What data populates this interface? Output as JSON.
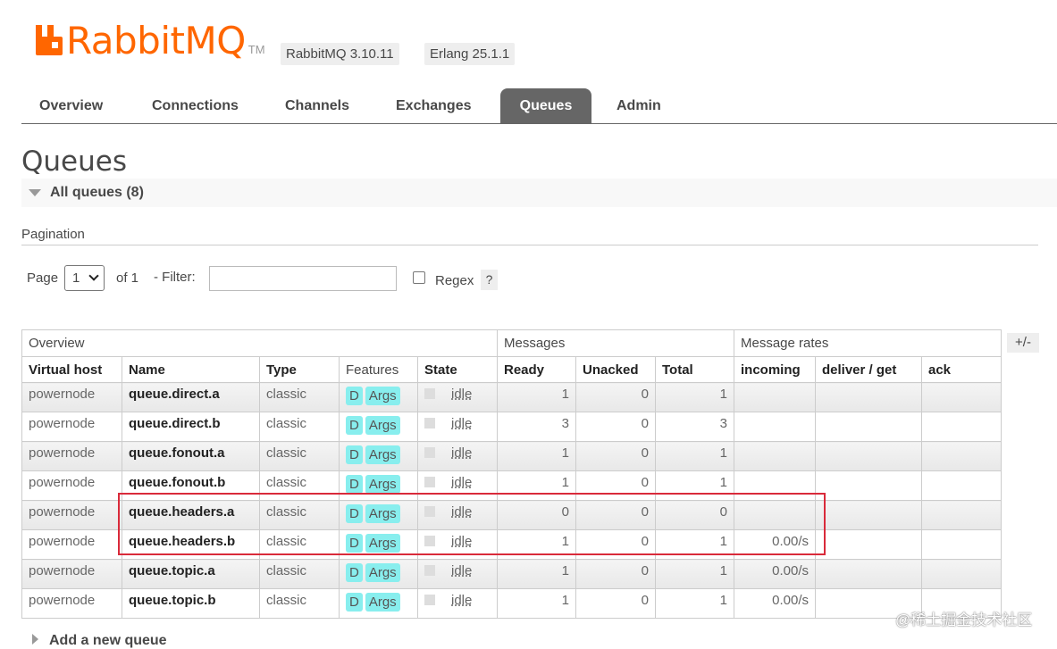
{
  "header": {
    "brand": "RabbitMQ",
    "tm": "TM",
    "version": "RabbitMQ 3.10.11",
    "erlang": "Erlang 25.1.1",
    "colors": {
      "brand": "#ff6600",
      "tab_active_bg": "#666666",
      "feature_badge": "#88eeee",
      "highlight": "#d92a3a"
    }
  },
  "tabs": [
    {
      "label": "Overview",
      "active": false
    },
    {
      "label": "Connections",
      "active": false
    },
    {
      "label": "Channels",
      "active": false
    },
    {
      "label": "Exchanges",
      "active": false
    },
    {
      "label": "Queues",
      "active": true
    },
    {
      "label": "Admin",
      "active": false
    }
  ],
  "page": {
    "title": "Queues",
    "section_title": "All queues (8)"
  },
  "pagination": {
    "label": "Pagination",
    "page_label": "Page",
    "page_value": "1",
    "of_label": "of 1",
    "filter_label": "- Filter:",
    "filter_value": "",
    "regex_label": "Regex",
    "help": "?"
  },
  "table": {
    "groups": [
      "Overview",
      "Messages",
      "Message rates"
    ],
    "columns": [
      "Virtual host",
      "Name",
      "Type",
      "Features",
      "State",
      "Ready",
      "Unacked",
      "Total",
      "incoming",
      "deliver / get",
      "ack"
    ],
    "plus_minus": "+/-",
    "rows": [
      {
        "vhost": "powernode",
        "name": "queue.direct.a",
        "type": "classic",
        "f1": "D",
        "f2": "Args",
        "state": "idle",
        "ready": "1",
        "unacked": "0",
        "total": "1",
        "incoming": "",
        "deliver": "",
        "ack": ""
      },
      {
        "vhost": "powernode",
        "name": "queue.direct.b",
        "type": "classic",
        "f1": "D",
        "f2": "Args",
        "state": "idle",
        "ready": "3",
        "unacked": "0",
        "total": "3",
        "incoming": "",
        "deliver": "",
        "ack": ""
      },
      {
        "vhost": "powernode",
        "name": "queue.fonout.a",
        "type": "classic",
        "f1": "D",
        "f2": "Args",
        "state": "idle",
        "ready": "1",
        "unacked": "0",
        "total": "1",
        "incoming": "",
        "deliver": "",
        "ack": ""
      },
      {
        "vhost": "powernode",
        "name": "queue.fonout.b",
        "type": "classic",
        "f1": "D",
        "f2": "Args",
        "state": "idle",
        "ready": "1",
        "unacked": "0",
        "total": "1",
        "incoming": "",
        "deliver": "",
        "ack": ""
      },
      {
        "vhost": "powernode",
        "name": "queue.headers.a",
        "type": "classic",
        "f1": "D",
        "f2": "Args",
        "state": "idle",
        "ready": "0",
        "unacked": "0",
        "total": "0",
        "incoming": "",
        "deliver": "",
        "ack": ""
      },
      {
        "vhost": "powernode",
        "name": "queue.headers.b",
        "type": "classic",
        "f1": "D",
        "f2": "Args",
        "state": "idle",
        "ready": "1",
        "unacked": "0",
        "total": "1",
        "incoming": "0.00/s",
        "deliver": "",
        "ack": ""
      },
      {
        "vhost": "powernode",
        "name": "queue.topic.a",
        "type": "classic",
        "f1": "D",
        "f2": "Args",
        "state": "idle",
        "ready": "1",
        "unacked": "0",
        "total": "1",
        "incoming": "0.00/s",
        "deliver": "",
        "ack": ""
      },
      {
        "vhost": "powernode",
        "name": "queue.topic.b",
        "type": "classic",
        "f1": "D",
        "f2": "Args",
        "state": "idle",
        "ready": "1",
        "unacked": "0",
        "total": "1",
        "incoming": "0.00/s",
        "deliver": "",
        "ack": ""
      }
    ]
  },
  "footer": {
    "add_queue": "Add a new queue",
    "watermark": "@稀土掘金技术社区"
  }
}
